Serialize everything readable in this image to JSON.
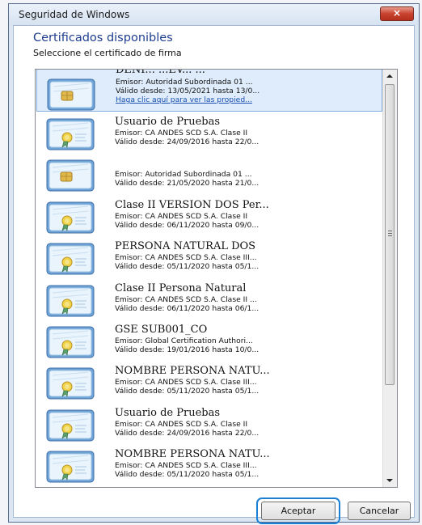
{
  "window": {
    "title": "Seguridad de Windows",
    "close_glyph": "×"
  },
  "header": {
    "title": "Certificados disponibles",
    "subtitle": "Seleccione el certificado de firma"
  },
  "certificates": [
    {
      "name": "DENI... ...EV... ...",
      "issuer": "Emisor: Autoridad Subordinada 01 ...",
      "validity": "Válido desde: 13/05/2021 hasta 13/0...",
      "link": "Haga clic aquí para ver las propied...",
      "icon": "smartcard-certificate-icon",
      "selected": true
    },
    {
      "name": "Usuario de Pruebas",
      "issuer": "Emisor: CA ANDES SCD S.A. Clase II",
      "validity": "Válido desde: 24/09/2016 hasta 22/0...",
      "icon": "certificate-icon"
    },
    {
      "name": "",
      "issuer": "Emisor: Autoridad Subordinada 01 ...",
      "validity": "Válido desde: 21/05/2020 hasta 21/0...",
      "icon": "smartcard-certificate-icon"
    },
    {
      "name": "Clase II VERSION DOS Per...",
      "issuer": "Emisor: CA ANDES SCD S.A. Clase II",
      "validity": "Válido desde: 06/11/2020 hasta 09/0...",
      "icon": "certificate-icon"
    },
    {
      "name": "PERSONA NATURAL DOS",
      "issuer": "Emisor: CA ANDES SCD S.A. Clase III...",
      "validity": "Válido desde: 05/11/2020 hasta 05/1...",
      "icon": "certificate-icon"
    },
    {
      "name": "Clase II Persona Natural",
      "issuer": "Emisor: CA ANDES SCD S.A. Clase II ...",
      "validity": "Válido desde: 06/11/2020 hasta 06/1...",
      "icon": "certificate-icon"
    },
    {
      "name": "GSE SUB001_CO",
      "issuer": "Emisor: Global Certification Authori...",
      "validity": "Válido desde: 19/01/2016 hasta 10/0...",
      "icon": "certificate-icon"
    },
    {
      "name": "NOMBRE PERSONA NATU...",
      "issuer": "Emisor: CA ANDES SCD S.A. Clase III...",
      "validity": "Válido desde: 05/11/2020 hasta 05/1...",
      "icon": "certificate-icon"
    },
    {
      "name": "Usuario de Pruebas",
      "issuer": "Emisor: CA ANDES SCD S.A. Clase II",
      "validity": "Válido desde: 24/09/2016 hasta 22/0...",
      "icon": "certificate-icon"
    },
    {
      "name": "NOMBRE PERSONA NATU...",
      "issuer": "Emisor: CA ANDES SCD S.A. Clase III...",
      "validity": "Válido desde: 05/11/2020 hasta 05/1...",
      "icon": "certificate-icon"
    }
  ],
  "buttons": {
    "accept": "Aceptar",
    "cancel": "Cancelar"
  },
  "colors": {
    "accent": "#1e3d8f",
    "selection": "#dfecfb",
    "highlight": "#1b7fd3",
    "close": "#c9432f"
  }
}
